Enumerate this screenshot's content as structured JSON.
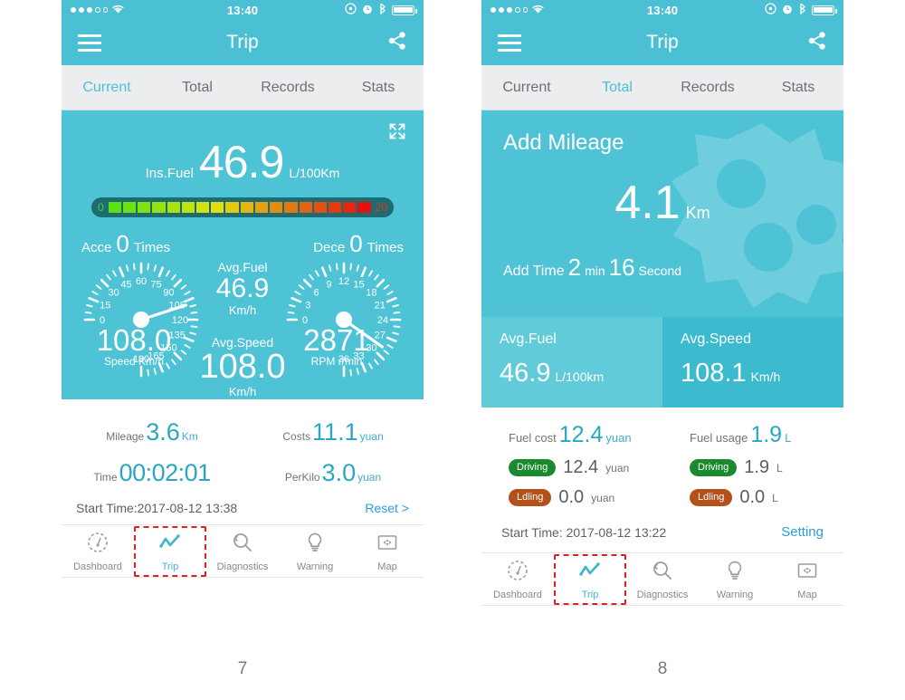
{
  "colors": {
    "teal": "#4BC0D4",
    "teal_panel": "#4FC3D6",
    "teal_light": "#62CBDA",
    "teal_dark": "#3CBACE",
    "accent_blue": "#2BA7C4",
    "link_blue": "#2F9CE0",
    "badge_green": "#1B8A2E",
    "badge_orange": "#B4501C",
    "highlight_red": "#E02020",
    "gauge_track": "#1F6B72"
  },
  "statusbar": {
    "time": "13:40",
    "signal_dots_filled": 3,
    "signal_dots_total": 5,
    "icons": [
      "wifi-icon",
      "rotation-lock-icon",
      "alarm-clock-icon",
      "bluetooth-icon",
      "battery-icon"
    ]
  },
  "navbar": {
    "title": "Trip",
    "menu_icon": "hamburger-menu-icon",
    "share_icon": "share-icon"
  },
  "tabs": {
    "items": [
      "Current",
      "Total",
      "Records",
      "Stats"
    ],
    "active_left": "Current",
    "active_right": "Total"
  },
  "left_screen": {
    "expand_icon": "fullscreen-expand-icon",
    "ins_fuel": {
      "label": "Ins.Fuel",
      "value": "46.9",
      "unit": "L/100Km"
    },
    "gauge_bar": {
      "min": "0",
      "max": "20",
      "segments": 18
    },
    "acce": {
      "label": "Acce",
      "value": "0",
      "unit": "Times"
    },
    "dece": {
      "label": "Dece",
      "value": "0",
      "unit": "Times"
    },
    "avg_fuel": {
      "label": "Avg.Fuel",
      "value": "46.9",
      "unit": "Km/h"
    },
    "avg_speed": {
      "label": "Avg.Speed",
      "value": "108.0",
      "unit": "Km/h"
    },
    "speedometer": {
      "value": "108.0",
      "caption": "Speed Km/h",
      "ticks": [
        "0",
        "15",
        "30",
        "45",
        "60",
        "75",
        "90",
        "105",
        "120",
        "135",
        "150",
        "165",
        "180"
      ],
      "min": 0,
      "max": 180,
      "needle": 108
    },
    "tachometer": {
      "value": "2871",
      "caption": "RPM r/min",
      "ticks": [
        "0",
        "3",
        "6",
        "9",
        "12",
        "15",
        "18",
        "21",
        "24",
        "27",
        "30",
        "33",
        "36"
      ],
      "min": 0,
      "max": 36,
      "needle": 28.71
    },
    "stats": [
      {
        "label": "Mileage",
        "value": "3.6",
        "unit": "Km"
      },
      {
        "label": "Costs",
        "value": "11.1",
        "unit": "yuan"
      },
      {
        "label": "Time",
        "value": "00:02:01",
        "unit": ""
      },
      {
        "label": "PerKilo",
        "value": "3.0",
        "unit": "yuan"
      }
    ],
    "start_time": "Start Time:2017-08-12 13:38",
    "reset_label": "Reset >"
  },
  "right_screen": {
    "hero": {
      "title": "Add Mileage",
      "value": "4.1",
      "unit": "Km",
      "time_label": "Add Time",
      "time_minutes": "2",
      "time_minutes_unit": "min",
      "time_seconds": "16",
      "time_seconds_unit": "Second",
      "watermark_icon": "gear-watermark-icon"
    },
    "avg_fuel": {
      "label": "Avg.Fuel",
      "value": "46.9",
      "unit": "L/100km"
    },
    "avg_speed": {
      "label": "Avg.Speed",
      "value": "108.1",
      "unit": "Km/h"
    },
    "fuel_cost": {
      "label": "Fuel cost",
      "value": "12.4",
      "unit": "yuan",
      "rows": [
        {
          "badge": "Driving",
          "value": "12.4",
          "unit": "yuan"
        },
        {
          "badge": "Ldling",
          "value": "0.0",
          "unit": "yuan"
        }
      ]
    },
    "fuel_usage": {
      "label": "Fuel usage",
      "value": "1.9",
      "unit": "L",
      "rows": [
        {
          "badge": "Driving",
          "value": "1.9",
          "unit": "L"
        },
        {
          "badge": "Ldling",
          "value": "0.0",
          "unit": "L"
        }
      ]
    },
    "start_time": "Start Time: 2017-08-12 13:22",
    "setting_label": "Setting"
  },
  "tabbar": {
    "items": [
      {
        "label": "Dashboard",
        "icon": "dashboard-gauge-icon"
      },
      {
        "label": "Trip",
        "icon": "trip-line-chart-icon"
      },
      {
        "label": "Diagnostics",
        "icon": "diagnostics-magnifier-icon"
      },
      {
        "label": "Warning",
        "icon": "warning-bulb-icon"
      },
      {
        "label": "Map",
        "icon": "map-frame-icon"
      }
    ],
    "active_index": 1
  },
  "page_numbers": {
    "left": "7",
    "right": "8"
  }
}
